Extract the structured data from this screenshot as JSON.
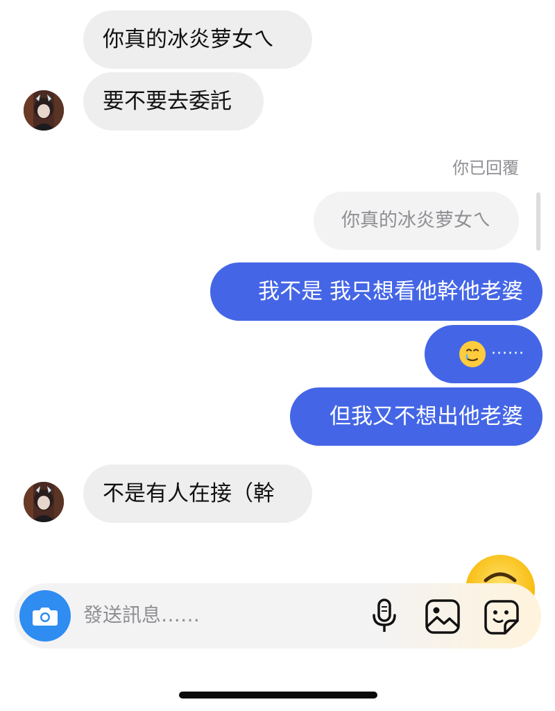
{
  "messages": [
    {
      "side": "in",
      "text": "你真的冰炎萝女ㄟ"
    },
    {
      "side": "in",
      "text": "要不要去委託"
    },
    {
      "side": "out",
      "text": "我不是 我只想看他幹他老婆"
    },
    {
      "side": "out",
      "text": "······"
    },
    {
      "side": "out",
      "text": "但我又不想出他老婆"
    },
    {
      "side": "in",
      "text": "不是有人在接（幹"
    }
  ],
  "reply": {
    "label": "你已回覆",
    "quoted": "你真的冰炎萝女ㄟ"
  },
  "composer": {
    "placeholder": "發送訊息……"
  },
  "colors": {
    "outgoing_bubble": "#4466e6",
    "incoming_bubble": "#eeeeef",
    "camera_button": "#2f8cf0"
  },
  "icons": [
    "camera-icon",
    "microphone-icon",
    "image-icon",
    "sticker-icon",
    "crying-smile-emoji",
    "smiling-emoji"
  ]
}
